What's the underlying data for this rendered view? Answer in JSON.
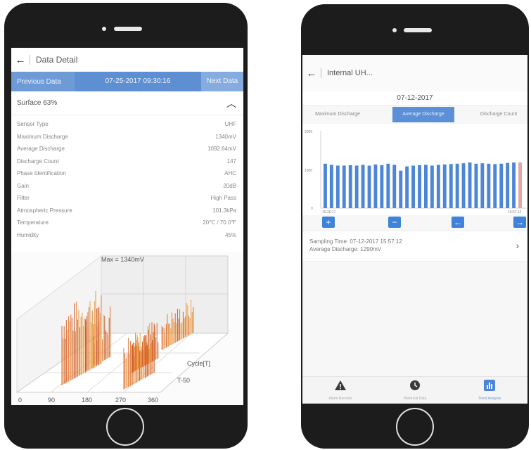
{
  "left": {
    "header_title": "Data Detail",
    "nav": {
      "previous_label": "Previous Data",
      "datetime": "07-25-2017 09:30:16",
      "next_label": "Next Data"
    },
    "section_title": "Surface 63%",
    "details": [
      {
        "label": "Sensor Type",
        "value": "UHF"
      },
      {
        "label": "Maximum Discharge",
        "value": "1340mV"
      },
      {
        "label": "Average Discharge",
        "value": "1092.64mV"
      },
      {
        "label": "Discharge Count",
        "value": "147"
      },
      {
        "label": "Phase Identification",
        "value": "AHC"
      },
      {
        "label": "Gain",
        "value": "20dB"
      },
      {
        "label": "Filter",
        "value": "High Pass"
      },
      {
        "label": "Atmospheric Pressure",
        "value": "101.3kPa"
      },
      {
        "label": "Temperature",
        "value": "20℃ / 70.0℉"
      },
      {
        "label": "Humidity",
        "value": "45%"
      }
    ],
    "chart3d": {
      "max_label": "Max = 1340mV",
      "axis_cycle_label": "Cycle[T]",
      "axis_t_label": "T-50",
      "phase_ticks": [
        "0",
        "90",
        "180",
        "270",
        "360"
      ]
    }
  },
  "right": {
    "header_title": "Internal UH...",
    "date": "07-12-2017",
    "segments": [
      "Maximum Discharge",
      "Average Discharge",
      "Discharge Count"
    ],
    "active_segment": "Average Discharge",
    "sampling_time_text": "Sampling Time: 07-12-2017 15:57:12",
    "average_discharge_text": "Average Discharge: 1290mV",
    "tabs": [
      {
        "label": "Alarm Records",
        "icon": "warning-icon"
      },
      {
        "label": "Historical Data",
        "icon": "clock-icon"
      },
      {
        "label": "Trend Analysis",
        "icon": "bar-chart-icon"
      }
    ],
    "active_tab": "Trend Analysis"
  },
  "chart_data": {
    "type": "bar",
    "title": "",
    "ylim": [
      0,
      2000
    ],
    "yticks": [
      "2000",
      "1000",
      "0"
    ],
    "x_start_label": "15:26:17",
    "x_end_label": "15:57:12",
    "values": [
      1150,
      1120,
      1100,
      1100,
      1110,
      1100,
      1120,
      1100,
      1130,
      1110,
      1150,
      1120,
      970,
      1080,
      1100,
      1110,
      1120,
      1100,
      1120,
      1130,
      1140,
      1150,
      1160,
      1180,
      1150,
      1160,
      1150,
      1140,
      1150,
      1170,
      1180,
      1180
    ],
    "bar_color": "#4d86d6",
    "last_bar_color": "#e3a6a6",
    "controls": [
      "+",
      "−",
      "←",
      "→"
    ]
  }
}
